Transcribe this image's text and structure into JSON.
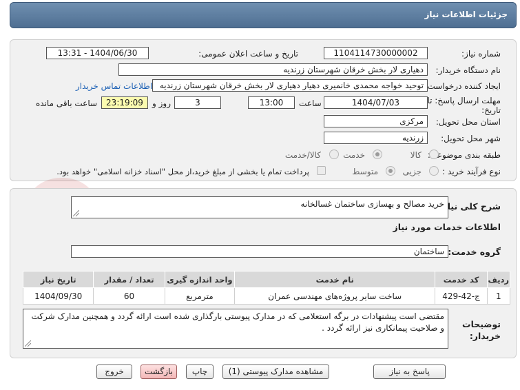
{
  "header": {
    "title": "جزئیات اطلاعات نیاز"
  },
  "fields": {
    "need_number_label": "شماره نیاز:",
    "need_number": "1104114730000002",
    "announce_label": "تاریخ و ساعت اعلان عمومی:",
    "announce_value": "1404/06/30 - 13:31",
    "buyer_org_label": "نام دستگاه خریدار:",
    "buyer_org": "دهیاری لار بخش خرقان شهرستان زرندیه",
    "creator_label": "ایجاد کننده درخواست:",
    "creator": "توحید خواجه محمدی خانمیری دهیار دهیاری لار بخش خرقان شهرستان زرندیه",
    "contact_link": "اطلاعات تماس خریدار",
    "deadline_label": "مهلت ارسال پاسخ: تا تاریخ:",
    "deadline_date": "1404/07/03",
    "time_label": "ساعت",
    "deadline_time": "13:00",
    "days_value": "3",
    "days_label": "روز و",
    "remaining_time": "23:19:09",
    "remaining_label": "ساعت باقی مانده",
    "province_label": "استان محل تحویل:",
    "province": "مرکزی",
    "city_label": "شهر محل تحویل:",
    "city": "زرندیه",
    "category_label": "طبقه بندی موضوعی:",
    "category_options": [
      "کالا",
      "خدمت",
      "کالا/خدمت"
    ],
    "category_selected": "خدمت",
    "process_label": "نوع فرآیند خرید :",
    "process_options": [
      "جزیی",
      "متوسط"
    ],
    "process_selected": "متوسط",
    "payment_note": "پرداخت تمام یا بخشی از مبلغ خرید،از محل \"اسناد خزانه اسلامی\" خواهد بود."
  },
  "description": {
    "label": "شرح کلی نیاز:",
    "value": "خرید مصالح و بهسازی ساختمان غسالخانه"
  },
  "services": {
    "section_title": "اطلاعات خدمات مورد نیاز",
    "group_label": "گروه خدمت:",
    "group_value": "ساختمان",
    "columns": [
      "ردیف",
      "کد خدمت",
      "نام خدمت",
      "واحد اندازه گیری",
      "تعداد / مقدار",
      "تاریخ نیاز"
    ],
    "rows": [
      [
        "1",
        "ج-42-429",
        "ساخت سایر پروژه‌های مهندسی عمران",
        "مترمربع",
        "60",
        "1404/09/30"
      ]
    ]
  },
  "buyer_notes": {
    "label": "توضیحات خریدار:",
    "value": "مقتضی است پیشنهادات در برگه استعلامی که در مدارک پیوستی بارگذاری شده است ارائه گردد و همچنین مدارک شرکت و صلاحیت پیمانکاری نیز ارائه گردد ."
  },
  "buttons": {
    "reply": "پاسخ به نیاز",
    "attachments": "مشاهده مدارک پیوستی (1)",
    "print": "چاپ",
    "back": "بازگشت",
    "exit": "خروج"
  },
  "watermark": {
    "text": "AriaTender.net"
  },
  "colors": {
    "header": "#5a7a9c",
    "panel": "#f1f1f1",
    "link": "#1a5fb4",
    "highlight": "#fbfbb0"
  }
}
